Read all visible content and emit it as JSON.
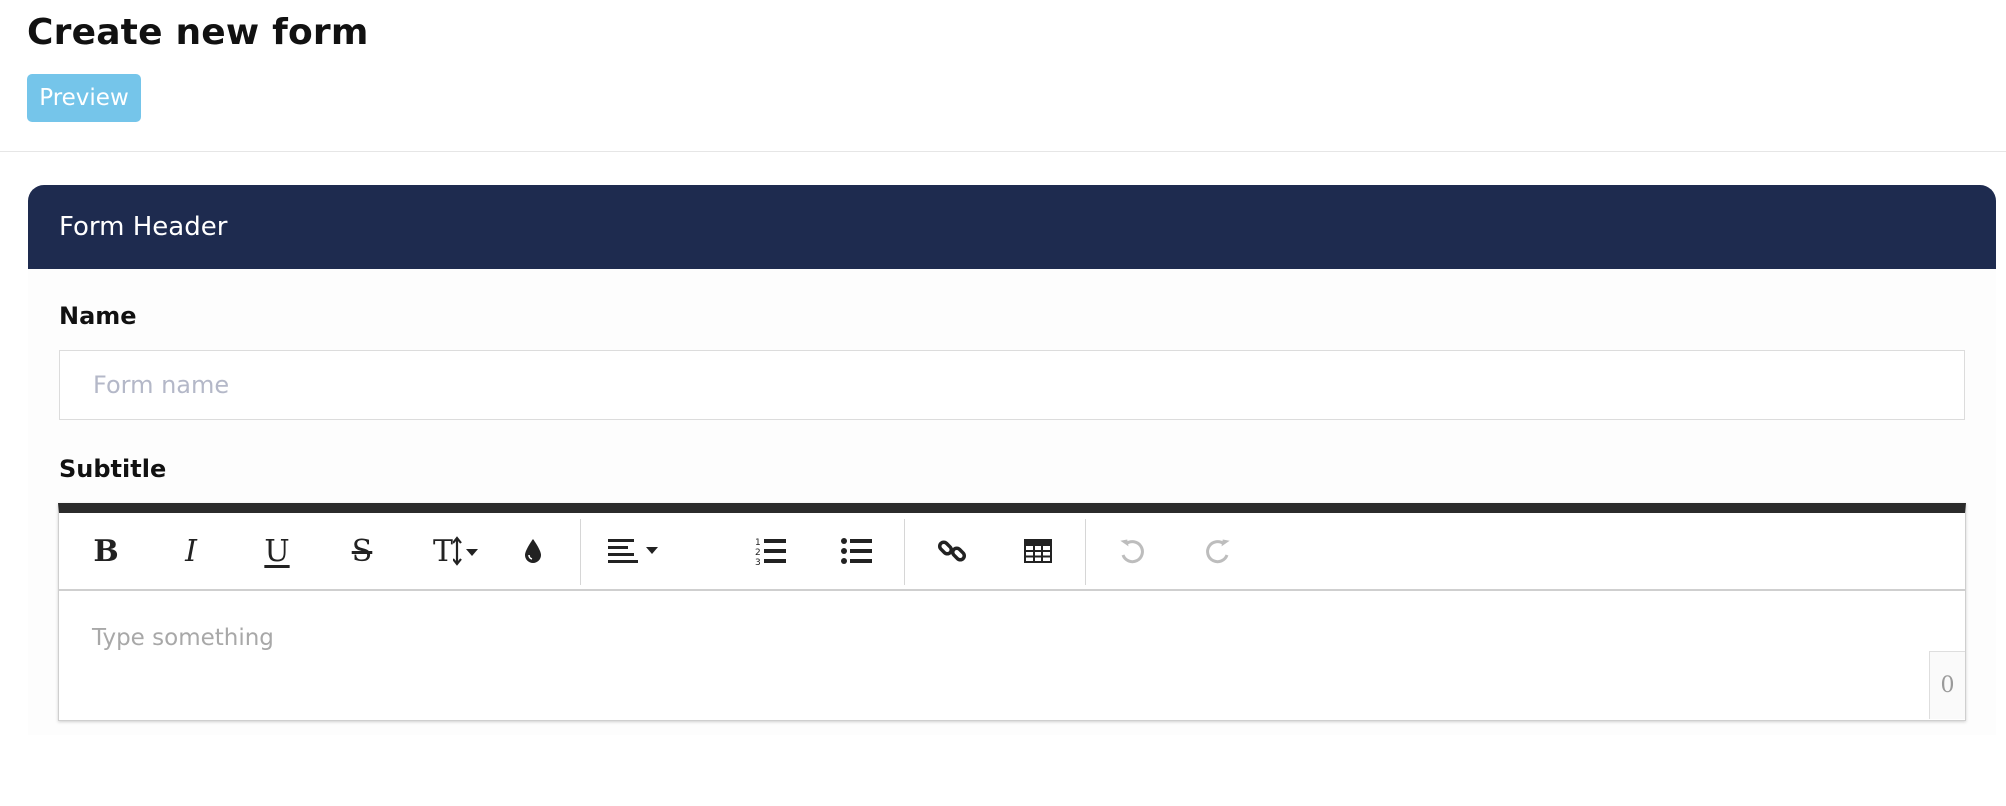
{
  "page": {
    "title": "Create new form",
    "preview_label": "Preview"
  },
  "card": {
    "header_title": "Form Header",
    "name_label": "Name",
    "name_placeholder": "Form name",
    "subtitle_label": "Subtitle"
  },
  "editor": {
    "placeholder": "Type something",
    "char_count": "0",
    "toolbar": {
      "bold": "B",
      "italic": "I",
      "underline": "U",
      "strikethrough": "S",
      "font_size": "T",
      "icons": [
        "bold-icon",
        "italic-icon",
        "underline-icon",
        "strikethrough-icon",
        "font-size-icon",
        "text-color-icon",
        "align-icon",
        "ordered-list-icon",
        "unordered-list-icon",
        "link-icon",
        "table-icon",
        "undo-icon",
        "redo-icon"
      ]
    }
  },
  "colors": {
    "preview_button": "#75c5ea",
    "card_header": "#1e2b4f",
    "toolbar_top_border": "#2b2b2b",
    "placeholder_text": "#b4b8c8"
  }
}
